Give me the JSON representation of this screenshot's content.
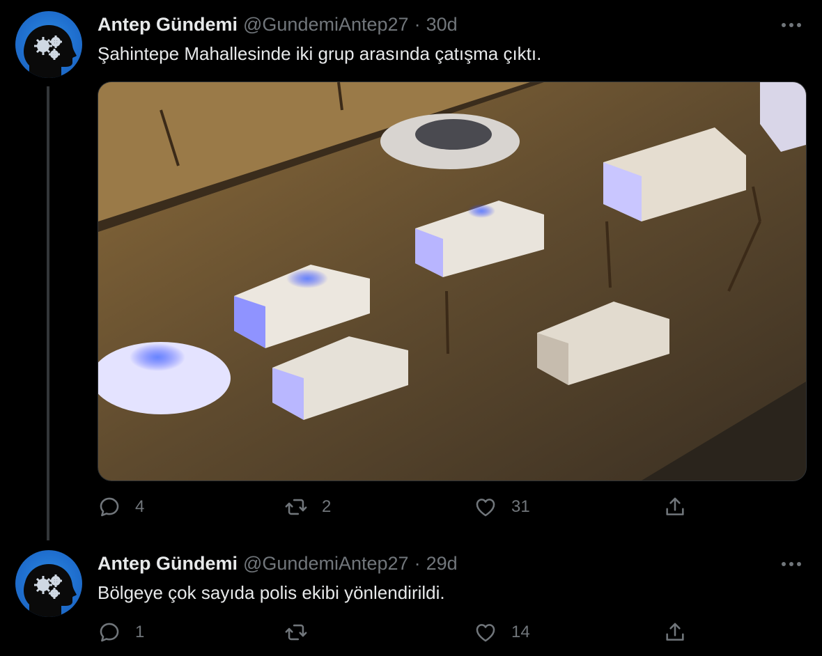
{
  "tweets": [
    {
      "display_name": "Antep Gündemi",
      "handle": "@GundemiAntep27",
      "separator": "·",
      "time": "30d",
      "text": "Şahintepe Mahallesinde iki grup arasında çatışma çıktı.",
      "avatar_icon": "head-gears-icon",
      "media_description_icon": "photo-icon",
      "actions": {
        "reply_count": "4",
        "retweet_count": "2",
        "like_count": "31",
        "share_count": ""
      }
    },
    {
      "display_name": "Antep Gündemi",
      "handle": "@GundemiAntep27",
      "separator": "·",
      "time": "29d",
      "text": "Bölgeye çok sayıda polis ekibi yönlendirildi.",
      "avatar_icon": "head-gears-icon",
      "actions": {
        "reply_count": "1",
        "retweet_count": "",
        "like_count": "14",
        "share_count": ""
      }
    }
  ],
  "colors": {
    "background": "#000000",
    "primary_text": "#e7e9ea",
    "secondary_text": "#71767b",
    "thread_line": "#333639",
    "avatar_blue": "#1f6fcf"
  }
}
